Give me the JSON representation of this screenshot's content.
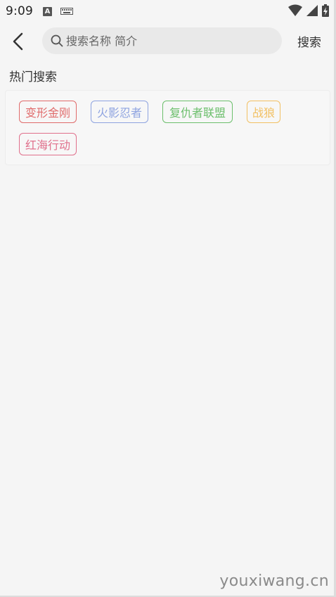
{
  "status_bar": {
    "time": "9:09",
    "notification_icon_letter": "A",
    "icons": [
      "keyboard-icon",
      "wifi-icon",
      "signal-icon",
      "battery-charging-icon"
    ]
  },
  "top_bar": {
    "back_icon": "chevron-left-icon",
    "search_placeholder": "搜索名称 简介",
    "search_value": "",
    "search_button_label": "搜索"
  },
  "hot_search": {
    "title": "热门搜索",
    "tags": [
      {
        "label": "变形金刚",
        "color": "#e06b6b"
      },
      {
        "label": "火影忍者",
        "color": "#8ea3e0"
      },
      {
        "label": "复仇者联盟",
        "color": "#6cbf6c"
      },
      {
        "label": "战狼",
        "color": "#f2c063"
      },
      {
        "label": "红海行动",
        "color": "#e0708c"
      }
    ]
  },
  "watermark": "youxiwang.cn"
}
